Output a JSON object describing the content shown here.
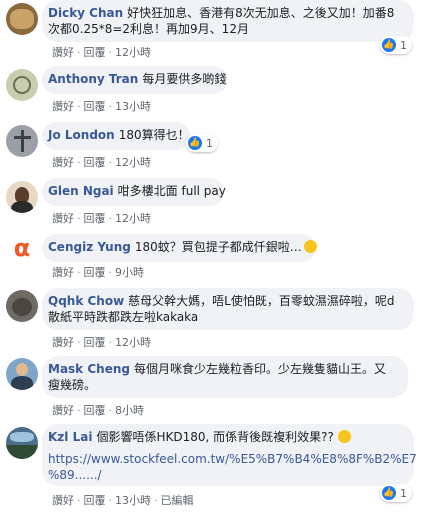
{
  "actions": {
    "like": "讚好",
    "reply": "回覆",
    "sep": "·",
    "edited": "已編輯"
  },
  "comments": [
    {
      "name": "Dicky Chan",
      "lines": [
        "好快狂加息、香港有8次无加息、之後又加！加番8",
        "次都0.25*8=2利息！再加9月、12月"
      ],
      "time": "12小時",
      "reactions": "1"
    },
    {
      "name": "Anthony Tran",
      "lines": [
        "每月要供多啲錢"
      ],
      "time": "13小時"
    },
    {
      "name": "Jo London",
      "lines": [
        "180算得乜！"
      ],
      "time": "12小時",
      "reactions": "1"
    },
    {
      "name": "Glen Ngai",
      "lines": [
        "咁多樓北面 full pay"
      ],
      "time": "12小時"
    },
    {
      "name": "Cengiz Yung",
      "lines": [
        "180蚊？買包提子都成仟銀啦…"
      ],
      "time": "9小時"
    },
    {
      "name": "Qqhk Chow",
      "lines": [
        "慈母父幹大媽，唔L使怕既，百零蚊濕濕碎啦，呢d",
        "散紙平時跌都跌左啦kakaka"
      ],
      "time": "12小時"
    },
    {
      "name": "Mask Cheng",
      "lines": [
        "每個月咪食少左幾粒香印。少左幾隻貓山王。又",
        "瘦幾磅。"
      ],
      "time": "8小時"
    },
    {
      "name": "Kzl Lai",
      "lines": [
        "個影響唔係HKD180, 而係背後既複利效果??"
      ],
      "link": [
        "https://www.stockfeel.com.tw/%E5%B7%B4%E8%8F%B2%E7",
        "%89....../"
      ],
      "time": "13小時",
      "reactions": "1"
    }
  ]
}
